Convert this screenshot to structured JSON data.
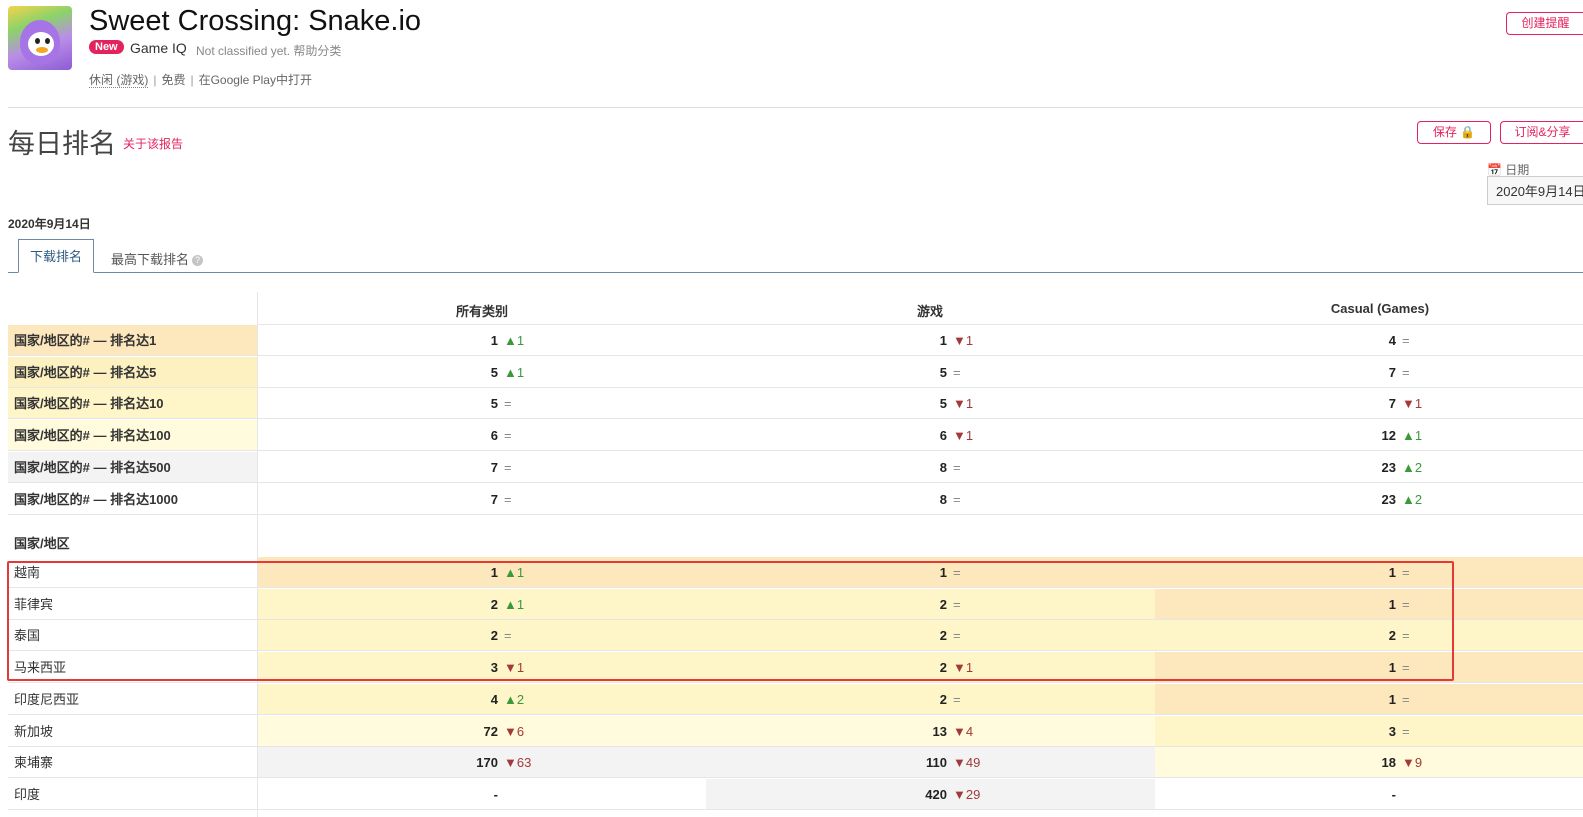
{
  "app": {
    "title": "Sweet Crossing: Snake.io",
    "badge": "New",
    "game_iq": "Game IQ",
    "classification": "Not classified yet. 帮助分类",
    "category": "休闲 (游戏)",
    "price": "免费",
    "store_link": "在Google Play中打开",
    "meta_sep": "|"
  },
  "buttons": {
    "create_alert": "创建提醒",
    "save": "保存 🔒",
    "subscribe_share": "订阅&分享"
  },
  "report": {
    "title": "每日排名",
    "about": "关于该报告",
    "date_label": "📅 日期",
    "date_value": "2020年9月14日",
    "date_text": "2020年9月14日"
  },
  "tabs": {
    "downloads": "下载排名",
    "top_downloads": "最高下载排名",
    "help": "?"
  },
  "table": {
    "columns": [
      "所有类别",
      "游戏",
      "Casual (Games)"
    ],
    "section_label": "国家/地区",
    "summary_rows": [
      {
        "label": "国家/地区的# — 排名达1",
        "bg": "#fde7bd",
        "cells": [
          {
            "v": "1",
            "d": "▲1",
            "t": "up"
          },
          {
            "v": "1",
            "d": "▼1",
            "t": "down"
          },
          {
            "v": "4",
            "d": "=",
            "t": "same"
          }
        ]
      },
      {
        "label": "国家/地区的# — 排名达5",
        "bg": "#fdf1c2",
        "cells": [
          {
            "v": "5",
            "d": "▲1",
            "t": "up"
          },
          {
            "v": "5",
            "d": "=",
            "t": "same"
          },
          {
            "v": "7",
            "d": "=",
            "t": "same"
          }
        ]
      },
      {
        "label": "国家/地区的# — 排名达10",
        "bg": "#fef5c8",
        "cells": [
          {
            "v": "5",
            "d": "=",
            "t": "same"
          },
          {
            "v": "5",
            "d": "▼1",
            "t": "down"
          },
          {
            "v": "7",
            "d": "▼1",
            "t": "down"
          }
        ]
      },
      {
        "label": "国家/地区的# — 排名达100",
        "bg": "#fffbdc",
        "cells": [
          {
            "v": "6",
            "d": "=",
            "t": "same"
          },
          {
            "v": "6",
            "d": "▼1",
            "t": "down"
          },
          {
            "v": "12",
            "d": "▲1",
            "t": "up"
          }
        ]
      },
      {
        "label": "国家/地区的# — 排名达500",
        "bg": "#f3f3f3",
        "cells": [
          {
            "v": "7",
            "d": "=",
            "t": "same"
          },
          {
            "v": "8",
            "d": "=",
            "t": "same"
          },
          {
            "v": "23",
            "d": "▲2",
            "t": "up"
          }
        ]
      },
      {
        "label": "国家/地区的# — 排名达1000",
        "bg": "#ffffff",
        "cells": [
          {
            "v": "7",
            "d": "=",
            "t": "same"
          },
          {
            "v": "8",
            "d": "=",
            "t": "same"
          },
          {
            "v": "23",
            "d": "▲2",
            "t": "up"
          }
        ]
      }
    ],
    "country_rows": [
      {
        "label": "越南",
        "cells": [
          {
            "v": "1",
            "d": "▲1",
            "t": "up",
            "bg": "#fde7bd"
          },
          {
            "v": "1",
            "d": "=",
            "t": "same",
            "bg": "#fde7bd"
          },
          {
            "v": "1",
            "d": "=",
            "t": "same",
            "bg": "#fde7bd"
          }
        ]
      },
      {
        "label": "菲律宾",
        "cells": [
          {
            "v": "2",
            "d": "▲1",
            "t": "up",
            "bg": "#fef5c8"
          },
          {
            "v": "2",
            "d": "=",
            "t": "same",
            "bg": "#fef5c8"
          },
          {
            "v": "1",
            "d": "=",
            "t": "same",
            "bg": "#fde7bd"
          }
        ]
      },
      {
        "label": "泰国",
        "cells": [
          {
            "v": "2",
            "d": "=",
            "t": "same",
            "bg": "#fef5c8"
          },
          {
            "v": "2",
            "d": "=",
            "t": "same",
            "bg": "#fef5c8"
          },
          {
            "v": "2",
            "d": "=",
            "t": "same",
            "bg": "#fef5c8"
          }
        ]
      },
      {
        "label": "马来西亚",
        "cells": [
          {
            "v": "3",
            "d": "▼1",
            "t": "down",
            "bg": "#fef5c8"
          },
          {
            "v": "2",
            "d": "▼1",
            "t": "down",
            "bg": "#fef5c8"
          },
          {
            "v": "1",
            "d": "=",
            "t": "same",
            "bg": "#fde7bd"
          }
        ]
      },
      {
        "label": "印度尼西亚",
        "cells": [
          {
            "v": "4",
            "d": "▲2",
            "t": "up",
            "bg": "#fef5c8"
          },
          {
            "v": "2",
            "d": "=",
            "t": "same",
            "bg": "#fef5c8"
          },
          {
            "v": "1",
            "d": "=",
            "t": "same",
            "bg": "#fde7bd"
          }
        ]
      },
      {
        "label": "新加坡",
        "cells": [
          {
            "v": "72",
            "d": "▼6",
            "t": "down",
            "bg": "#fffbdc"
          },
          {
            "v": "13",
            "d": "▼4",
            "t": "down",
            "bg": "#fffbdc"
          },
          {
            "v": "3",
            "d": "=",
            "t": "same",
            "bg": "#fef5c8"
          }
        ]
      },
      {
        "label": "柬埔寨",
        "cells": [
          {
            "v": "170",
            "d": "▼63",
            "t": "down",
            "bg": "#f3f3f3"
          },
          {
            "v": "110",
            "d": "▼49",
            "t": "down",
            "bg": "#f3f3f3"
          },
          {
            "v": "18",
            "d": "▼9",
            "t": "down",
            "bg": "#fffbdc"
          }
        ]
      },
      {
        "label": "印度",
        "cells": [
          {
            "v": "-",
            "d": "",
            "t": "none",
            "bg": "#ffffff"
          },
          {
            "v": "420",
            "d": "▼29",
            "t": "down",
            "bg": "#f3f3f3"
          },
          {
            "v": "-",
            "d": "",
            "t": "none",
            "bg": "#ffffff"
          }
        ]
      }
    ]
  }
}
